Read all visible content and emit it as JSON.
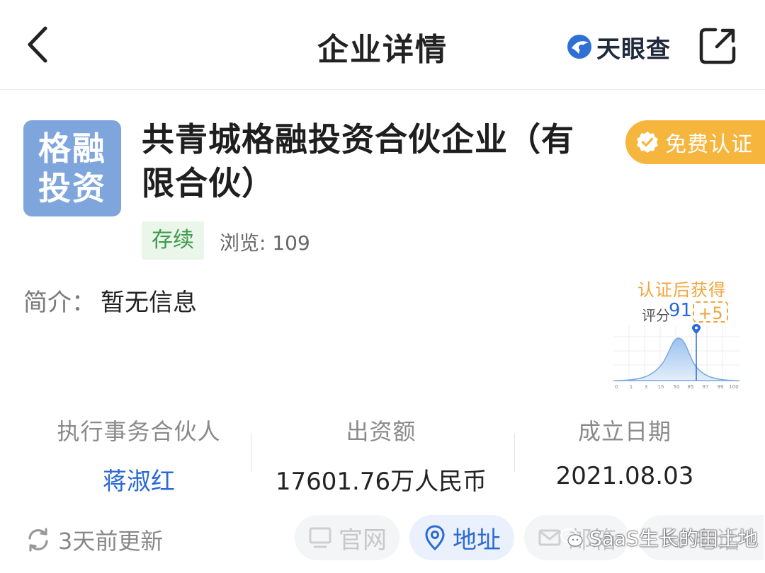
{
  "header": {
    "title": "企业详情",
    "brand_name": "天眼查"
  },
  "company": {
    "logo_line1": "格融",
    "logo_line2": "投资",
    "name_line1": "共青城格融投资合伙企业（有",
    "name_line2": "限合伙）",
    "certify_label": "免费认证",
    "status": "存续",
    "views_label": "浏览: ",
    "views_count": "109",
    "intro_label": "简介：",
    "intro_value": "暂无信息"
  },
  "score": {
    "title": "认证后获得",
    "label": "评分",
    "value": "91",
    "bonus": "+5",
    "axis_ticks": [
      "0",
      "1",
      "3",
      "15",
      "50",
      "85",
      "97",
      "99",
      "100"
    ]
  },
  "stats": [
    {
      "label": "执行事务合伙人",
      "value": "蒋淑红"
    },
    {
      "label": "出资额",
      "value": "17601.76万人民币"
    },
    {
      "label": "成立日期",
      "value": "2021.08.03"
    }
  ],
  "footer": {
    "update_text": "3天前更新",
    "website_label": "官网",
    "address_label": "地址",
    "email_label": "邮箱",
    "phone_label": "电话",
    "watermark_text": "SaaS生长的田土地"
  },
  "colors": {
    "accent_blue": "#2b6ad4",
    "cert_orange": "#f6b53d",
    "logo_blue": "#7fa6dc",
    "status_green": "#3f9a4b"
  }
}
